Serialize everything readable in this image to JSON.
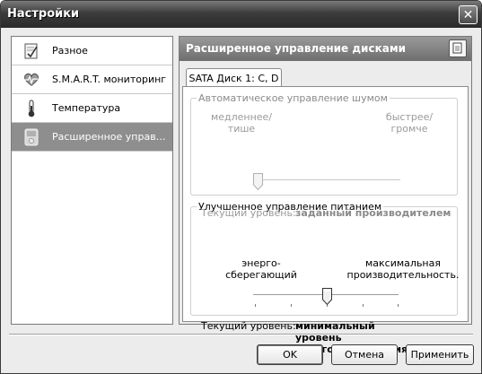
{
  "window": {
    "title": "Настройки",
    "close_label": "✕"
  },
  "nav": {
    "items": [
      {
        "label": "Разное",
        "icon": "notepad-icon"
      },
      {
        "label": "S.M.A.R.T. мониторинг",
        "icon": "heart-monitor-icon"
      },
      {
        "label": "Температура",
        "icon": "thermometer-icon"
      },
      {
        "label": "Расширенное управ…",
        "icon": "device-icon",
        "selected": true
      }
    ]
  },
  "panel": {
    "title": "Расширенное управление дисками",
    "tab": "SATA Диск 1: C, D",
    "noise": {
      "legend": "Автоматическое управление шумом",
      "left_label_1": "медленнее/",
      "left_label_2": "тише",
      "right_label_1": "быстрее/",
      "right_label_2": "громче",
      "level_label": "Текущий уровень:",
      "level_value": "заданный производителем",
      "enabled": false,
      "slider_position": 0.0
    },
    "power": {
      "legend": "Улучшенное управление питанием",
      "left_label_1": "энерго-",
      "left_label_2": "сберегающий",
      "right_label_1": "максимальная",
      "right_label_2": "производительность.",
      "level_label": "Текущий уровень:",
      "level_value_1": "минимальный уровень",
      "level_value_2": "энергопотребления",
      "enabled": true,
      "slider_position": 0.5
    }
  },
  "buttons": {
    "ok": "OK",
    "cancel": "Отмена",
    "apply": "Применить"
  }
}
